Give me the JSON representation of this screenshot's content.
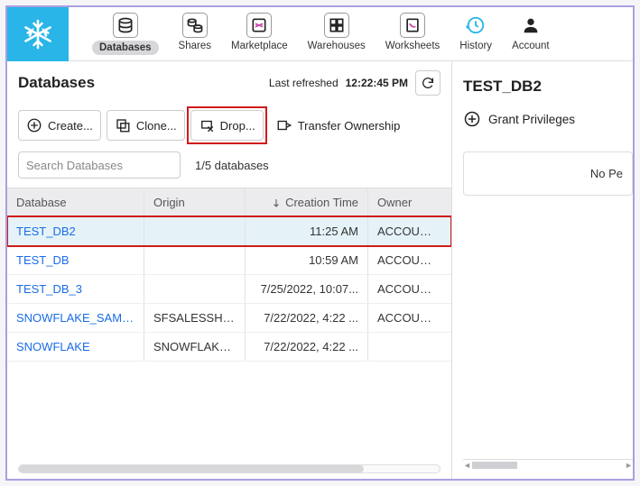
{
  "nav": {
    "items": [
      {
        "label": "Databases",
        "icon": "database"
      },
      {
        "label": "Shares",
        "icon": "shares"
      },
      {
        "label": "Marketplace",
        "icon": "marketplace"
      },
      {
        "label": "Warehouses",
        "icon": "warehouses"
      },
      {
        "label": "Worksheets",
        "icon": "worksheets"
      },
      {
        "label": "History",
        "icon": "history"
      },
      {
        "label": "Account",
        "icon": "account"
      }
    ]
  },
  "page": {
    "title": "Databases",
    "refresh_label": "Last refreshed",
    "refresh_time": "12:22:45 PM"
  },
  "toolbar": {
    "create": "Create...",
    "clone": "Clone...",
    "drop": "Drop...",
    "transfer": "Transfer Ownership"
  },
  "filter": {
    "placeholder": "Search Databases",
    "count": "1/5 databases"
  },
  "table": {
    "headers": {
      "database": "Database",
      "origin": "Origin",
      "creation": "Creation Time",
      "owner": "Owner"
    },
    "rows": [
      {
        "db": "TEST_DB2",
        "origin": "",
        "created": "11:25 AM",
        "owner": "ACCOUNTAD"
      },
      {
        "db": "TEST_DB",
        "origin": "",
        "created": "10:59 AM",
        "owner": "ACCOUNTAD"
      },
      {
        "db": "TEST_DB_3",
        "origin": "",
        "created": "7/25/2022, 10:07...",
        "owner": "ACCOUNTAD"
      },
      {
        "db": "SNOWFLAKE_SAMPL...",
        "origin": "SFSALESSHAR...",
        "created": "7/22/2022, 4:22 ...",
        "owner": "ACCOUNTAD"
      },
      {
        "db": "SNOWFLAKE",
        "origin": "SNOWFLAKE.A...",
        "created": "7/22/2022, 4:22 ...",
        "owner": ""
      }
    ]
  },
  "side": {
    "title": "TEST_DB2",
    "grant": "Grant Privileges",
    "box_text": "No Pe"
  }
}
